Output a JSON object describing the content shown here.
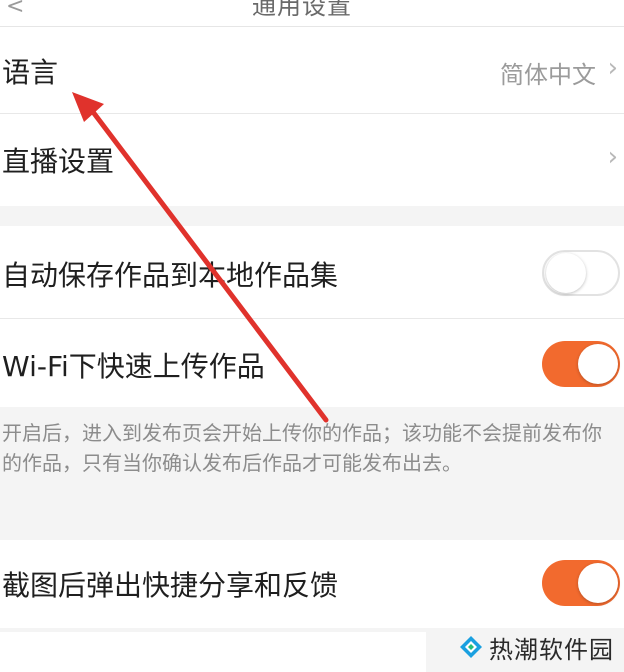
{
  "header": {
    "back_glyph": "<",
    "title": "通用设置"
  },
  "settings": {
    "language": {
      "label": "语言",
      "value": "简体中文"
    },
    "live": {
      "label": "直播设置"
    },
    "auto_save": {
      "label": "自动保存作品到本地作品集",
      "enabled": false
    },
    "wifi_upload": {
      "label": "Wi-Fi下快速上传作品",
      "enabled": true,
      "description": "开启后，进入到发布页会开始上传你的作品；该功能不会提前发布你的作品，只有当你确认发布后作品才可能发布出去。"
    },
    "screenshot_share": {
      "label": "截图后弹出快捷分享和反馈",
      "enabled": true
    }
  },
  "watermark": {
    "text": "热潮软件园",
    "logo_icon": "diamond-logo-icon"
  },
  "colors": {
    "toggle_on": "#f26a2e",
    "annotation_arrow": "#e0322c"
  },
  "icons": {
    "chevron": "chevron-right-icon"
  }
}
